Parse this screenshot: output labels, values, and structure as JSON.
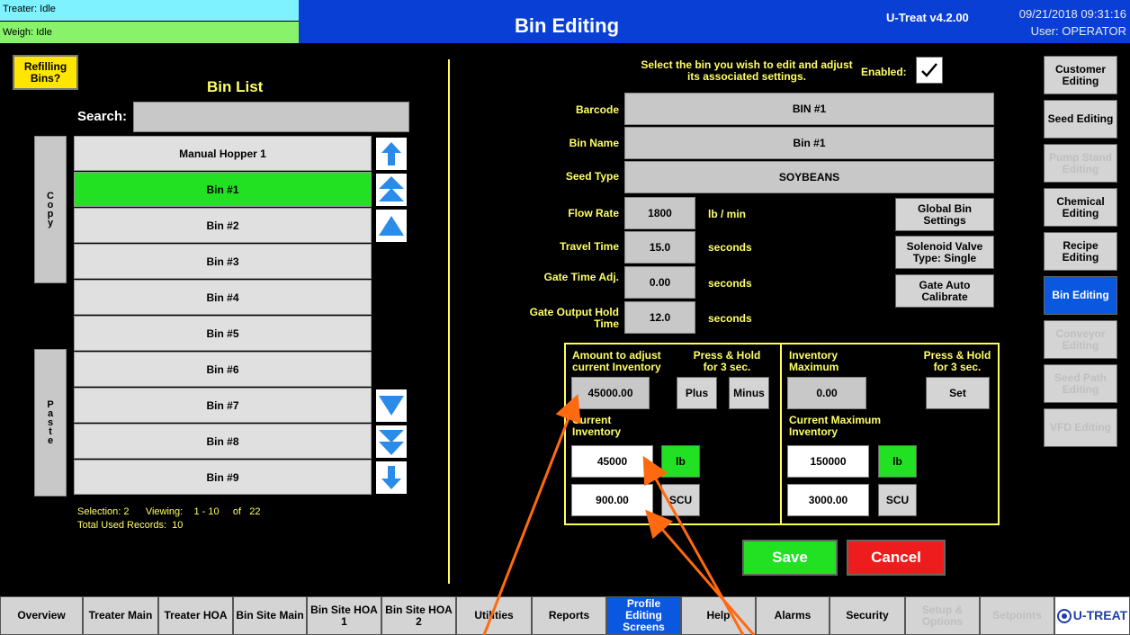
{
  "status": {
    "treater": "Treater: Idle",
    "weigh": "Weigh: Idle"
  },
  "header": {
    "title": "Bin Editing",
    "version": "U-Treat v4.2.00",
    "datetime": "09/21/2018 09:31:16",
    "user": "User: OPERATOR"
  },
  "left": {
    "refilling_label": "Refilling Bins?",
    "list_title": "Bin List",
    "search_label": "Search:",
    "search_value": "",
    "copy_label": [
      "C",
      "o",
      "p",
      "y"
    ],
    "paste_label": [
      "P",
      "a",
      "s",
      "t",
      "e"
    ],
    "rows": [
      "Manual Hopper 1",
      "Bin #1",
      "Bin #2",
      "Bin #3",
      "Bin #4",
      "Bin #5",
      "Bin #6",
      "Bin #7",
      "Bin #8",
      "Bin #9"
    ],
    "selected_index": 1,
    "selection_label": "Selection:",
    "selection_value": "2",
    "viewing_label": "Viewing:",
    "viewing_value": "1 - 10",
    "of_label": "of",
    "of_value": "22",
    "total_label": "Total Used Records:",
    "total_value": "10"
  },
  "edit": {
    "instruction": "Select the bin you wish to edit and adjust its associated settings.",
    "enabled_label": "Enabled:",
    "enabled_checked": true,
    "barcode_label": "Barcode",
    "barcode_value": "BIN #1",
    "binname_label": "Bin Name",
    "binname_value": "Bin #1",
    "seedtype_label": "Seed Type",
    "seedtype_value": "SOYBEANS",
    "flow_label": "Flow Rate",
    "flow_value": "1800",
    "flow_unit": "lb / min",
    "travel_label": "Travel Time",
    "travel_value": "15.0",
    "travel_unit": "seconds",
    "gate_adj_label": "Gate Time Adj.",
    "gate_adj_value": "0.00",
    "gate_adj_unit": "seconds",
    "gate_hold_label": "Gate Output Hold Time",
    "gate_hold_value": "12.0",
    "gate_hold_unit": "seconds",
    "global_btn": "Global Bin Settings",
    "solenoid_btn": "Solenoid Valve Type: Single",
    "gate_cal_btn": "Gate Auto Calibrate"
  },
  "inventory": {
    "adjust_label": "Amount to adjust current Inventory",
    "press_hold_1": "Press & Hold for 3 sec.",
    "adjust_value": "45000.00",
    "plus_label": "Plus",
    "minus_label": "Minus",
    "current_label": "Current Inventory",
    "current_lb": "45000",
    "lb_label_1": "lb",
    "current_scu": "900.00",
    "scu_label_1": "SCU",
    "max_label": "Inventory Maximum",
    "press_hold_2": "Press & Hold for 3 sec.",
    "max_value": "0.00",
    "set_label": "Set",
    "curmax_label": "Current Maximum Inventory",
    "curmax_lb": "150000",
    "lb_label_2": "lb",
    "curmax_scu": "3000.00",
    "scu_label_2": "SCU"
  },
  "actions": {
    "save": "Save",
    "cancel": "Cancel"
  },
  "right_nav": [
    {
      "label": "Customer Editing",
      "state": "normal"
    },
    {
      "label": "Seed Editing",
      "state": "normal"
    },
    {
      "label": "Pump Stand Editing",
      "state": "dim"
    },
    {
      "label": "Chemical Editing",
      "state": "normal"
    },
    {
      "label": "Recipe Editing",
      "state": "normal"
    },
    {
      "label": "Bin Editing",
      "state": "active"
    },
    {
      "label": "Conveyor Editing",
      "state": "dim"
    },
    {
      "label": "Seed Path Editing",
      "state": "dim"
    },
    {
      "label": "VFD Editing",
      "state": "dim"
    }
  ],
  "bottom_nav": [
    {
      "label": "Overview",
      "state": "normal"
    },
    {
      "label": "Treater Main",
      "state": "normal"
    },
    {
      "label": "Treater HOA",
      "state": "normal"
    },
    {
      "label": "Bin Site Main",
      "state": "normal"
    },
    {
      "label": "Bin Site HOA 1",
      "state": "normal"
    },
    {
      "label": "Bin Site HOA 2",
      "state": "normal"
    },
    {
      "label": "Utilities",
      "state": "normal"
    },
    {
      "label": "Reports",
      "state": "normal"
    },
    {
      "label": "Profile Editing Screens",
      "state": "active"
    },
    {
      "label": "Help",
      "state": "normal"
    },
    {
      "label": "Alarms",
      "state": "normal"
    },
    {
      "label": "Security",
      "state": "normal"
    },
    {
      "label": "Setup & Options",
      "state": "dim"
    },
    {
      "label": "Setpoints",
      "state": "dim"
    }
  ],
  "logo": {
    "text": "U-TREAT",
    "color": "#1f3fa8"
  },
  "colors": {
    "accent": "#0a58e0",
    "header": "#0a3fd6",
    "selected": "#22e022",
    "label": "#ffff66",
    "annotation": "#ff6a10"
  }
}
